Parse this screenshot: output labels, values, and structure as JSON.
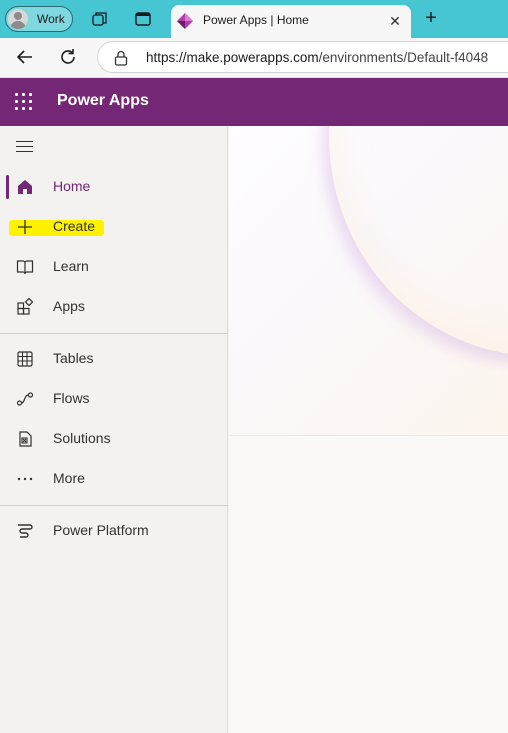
{
  "browser": {
    "profile_label": "Work",
    "tab_title": "Power Apps | Home",
    "url_host": "https://make.powerapps.com",
    "url_path": "/environments/Default-f4048"
  },
  "app": {
    "name": "Power Apps",
    "brand_color": "#742774"
  },
  "nav": {
    "home": "Home",
    "create": "Create",
    "learn": "Learn",
    "apps": "Apps",
    "tables": "Tables",
    "flows": "Flows",
    "solutions": "Solutions",
    "more": "More",
    "power_platform": "Power Platform",
    "active": "Home",
    "highlighted": "Create"
  }
}
